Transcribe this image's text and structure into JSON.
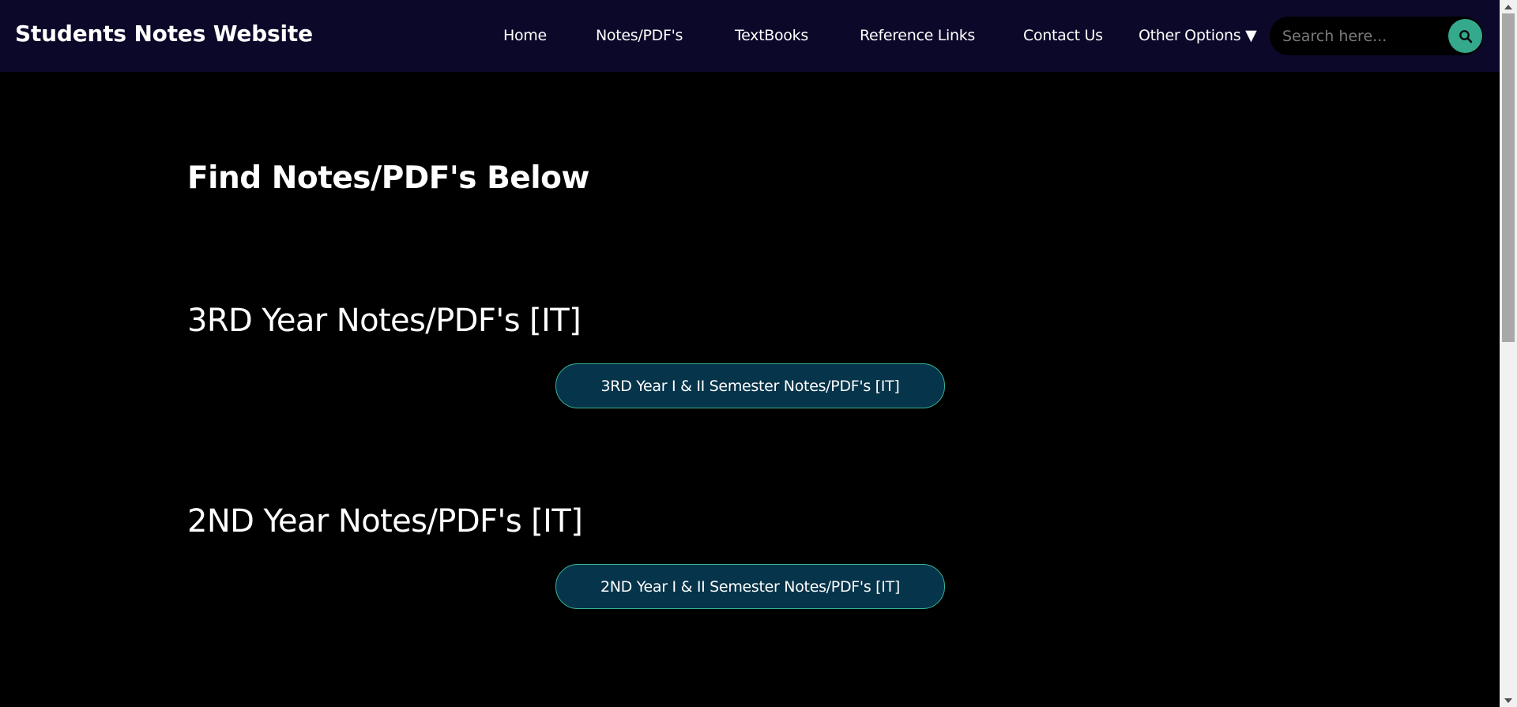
{
  "brand": "Students Notes Website",
  "nav": {
    "items": [
      {
        "label": "Home"
      },
      {
        "label": "Notes/PDF's"
      },
      {
        "label": "TextBooks"
      },
      {
        "label": "Reference Links"
      },
      {
        "label": "Contact Us"
      },
      {
        "label": "Other Options ▼"
      }
    ]
  },
  "search": {
    "placeholder": "Search here...",
    "value": "",
    "icon": "search-icon"
  },
  "main": {
    "heading": "Find Notes/PDF's Below",
    "sections": [
      {
        "heading": "3RD Year Notes/PDF's [IT]",
        "button_label": "3RD Year I & II Semester Notes/PDF's [IT]"
      },
      {
        "heading": "2ND Year Notes/PDF's [IT]",
        "button_label": "2ND Year I & II Semester Notes/PDF's [IT]"
      }
    ]
  },
  "colors": {
    "navbar_bg": "#0c0829",
    "page_bg": "#000000",
    "accent": "#34a98c",
    "button_bg": "#06344a",
    "button_border": "#38b596"
  }
}
